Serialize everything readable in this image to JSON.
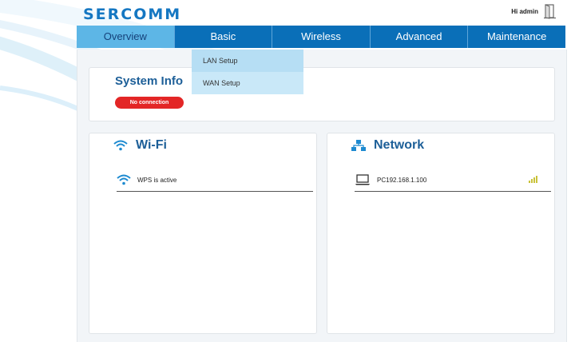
{
  "brand": {
    "logo": "SERCOMM"
  },
  "user": {
    "greeting": "Hi admin"
  },
  "nav": {
    "tabs": [
      {
        "label": "Overview"
      },
      {
        "label": "Basic"
      },
      {
        "label": "Wireless"
      },
      {
        "label": "Advanced"
      },
      {
        "label": "Maintenance"
      }
    ],
    "active": "Overview",
    "open_menu": "Basic"
  },
  "basic_menu": {
    "items": [
      {
        "label": "LAN Setup"
      },
      {
        "label": "WAN Setup"
      }
    ]
  },
  "system_info": {
    "title": "System Info",
    "status": "No connection",
    "status_color": "#e32626"
  },
  "wifi": {
    "title": "Wi-Fi",
    "icon": "wifi-icon",
    "rows": [
      {
        "text": "WPS is active",
        "icon": "wifi-icon"
      }
    ]
  },
  "network": {
    "title": "Network",
    "icon": "network-icon",
    "rows": [
      {
        "text": "PC192.168.1.100",
        "icon": "laptop-icon",
        "signal": "signal-icon"
      }
    ]
  },
  "colors": {
    "accent": "#0a6fb8",
    "active_tab": "#5db6e6",
    "title": "#1d5f98"
  }
}
